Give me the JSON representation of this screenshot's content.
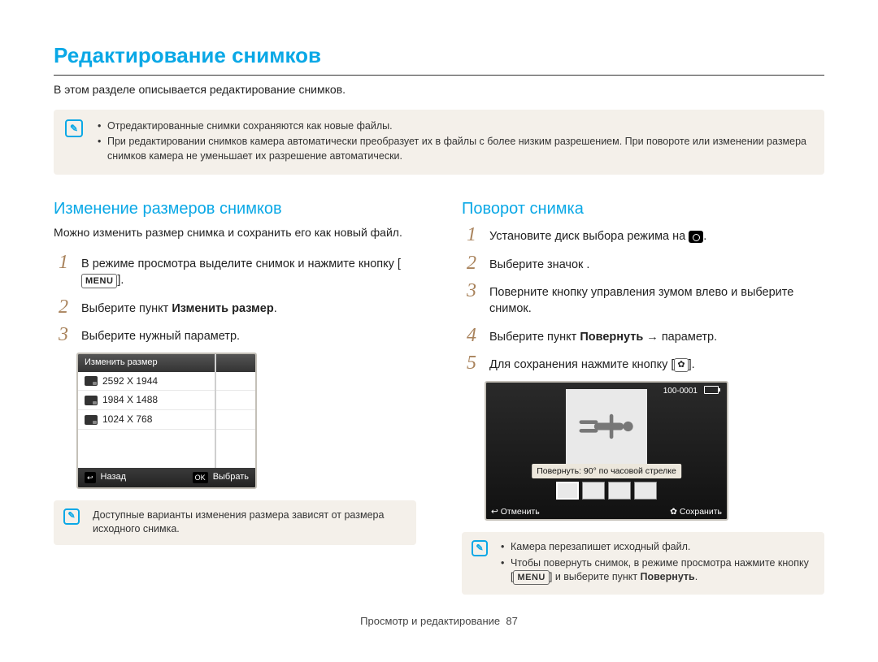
{
  "page": {
    "title": "Редактирование снимков",
    "intro": "В этом разделе описывается редактирование снимков.",
    "footer_section": "Просмотр и редактирование",
    "footer_page": "87"
  },
  "top_notes": [
    "Отредактированные снимки сохраняются как новые файлы.",
    "При редактировании снимков камера автоматически преобразует их в файлы с более низким разрешением. При повороте или изменении размера снимков камера не уменьшает их разрешение автоматически."
  ],
  "left": {
    "title": "Изменение размеров снимков",
    "lead": "Можно изменить размер снимка и сохранить его как новый файл.",
    "steps": [
      {
        "text_before": "В режиме просмотра выделите снимок и нажмите кнопку [",
        "btn": "MENU",
        "text_after": "]."
      },
      {
        "plain_before": "Выберите пункт ",
        "bold": "Изменить размер",
        "plain_after": "."
      },
      {
        "plain": "Выберите нужный параметр."
      }
    ],
    "lcd": {
      "header": "Изменить размер",
      "rows": [
        "2592 X 1944",
        "1984 X 1488",
        "1024 X 768"
      ],
      "back_btn": "↩",
      "back_label": "Назад",
      "ok_btn": "OK",
      "ok_label": "Выбрать"
    },
    "foot_note": "Доступные варианты изменения размера зависят от размера исходного снимка."
  },
  "right": {
    "title": "Поворот снимка",
    "steps": [
      {
        "t1": "Установите диск выбора режима на ",
        "icon": "camera",
        "t2": "."
      },
      {
        "plain": "Выберите значок       ."
      },
      {
        "plain": "Поверните кнопку управления зумом влево и выберите снимок."
      },
      {
        "t1": "Выберите пункт ",
        "bold": "Повернуть",
        "t2": " → параметр."
      },
      {
        "t1": "Для сохранения нажмите кнопку [",
        "btn": "✿",
        "t2": "]."
      }
    ],
    "lcd": {
      "file_id": "100-0001",
      "rotate_label": "Повернуть: 90° по часовой стрелке",
      "cancel": "Отменить",
      "save": "Сохранить"
    },
    "foot_notes": [
      "Камера перезапишет исходный файл.",
      {
        "t1": "Чтобы повернуть снимок, в режиме просмотра нажмите кнопку [",
        "btn": "MENU",
        "t2": "] и выберите пункт ",
        "bold": "Повернуть",
        "t3": "."
      }
    ]
  }
}
